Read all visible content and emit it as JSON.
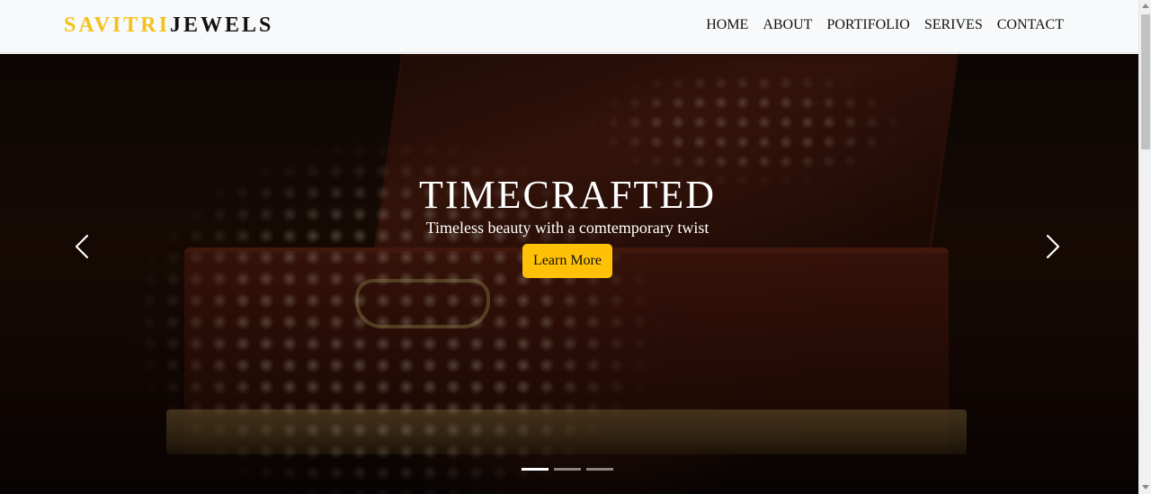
{
  "brand": {
    "part1": "SAVITRI",
    "part2": "JEWELS",
    "accent_color": "#f4c21a"
  },
  "nav": {
    "items": [
      "HOME",
      "ABOUT",
      "PORTIFOLIO",
      "SERIVES",
      "CONTACT"
    ]
  },
  "hero": {
    "title": "TIMECRAFTED",
    "subtitle": "Timeless beauty with a comtemporary twist",
    "button_label": "Learn More",
    "button_color": "#ffc107",
    "prev_icon": "chevron-left-icon",
    "next_icon": "chevron-right-icon",
    "slide_count": 3,
    "active_slide": 1
  }
}
